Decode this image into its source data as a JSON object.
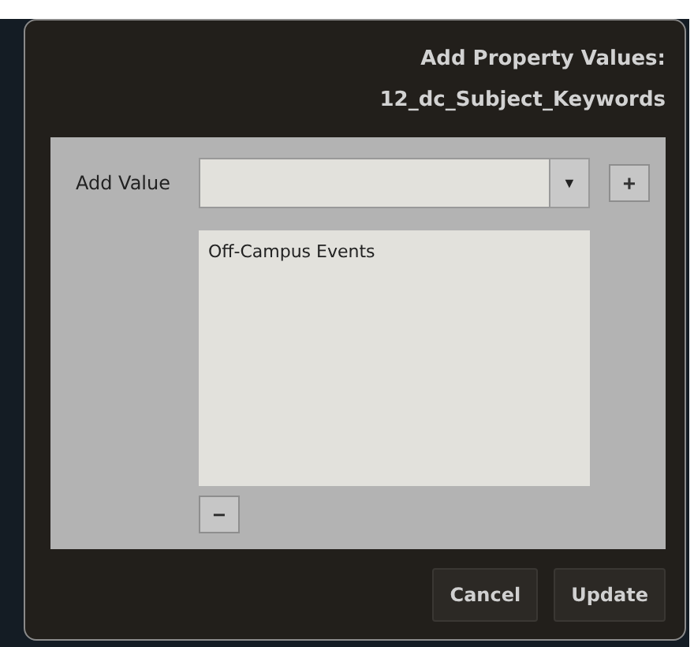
{
  "dialog": {
    "title_lines": [
      "Add Property Values:",
      "12_dc_Subject_Keywords"
    ],
    "add_value": {
      "label": "Add Value",
      "dropdown": "▼",
      "add_button": "+"
    },
    "values": [
      {
        "text": "Off-Campus Events",
        "selected": false
      }
    ],
    "remove_button": "−",
    "buttons": [
      {
        "label": "Cancel"
      },
      {
        "label": "Update"
      }
    ]
  }
}
